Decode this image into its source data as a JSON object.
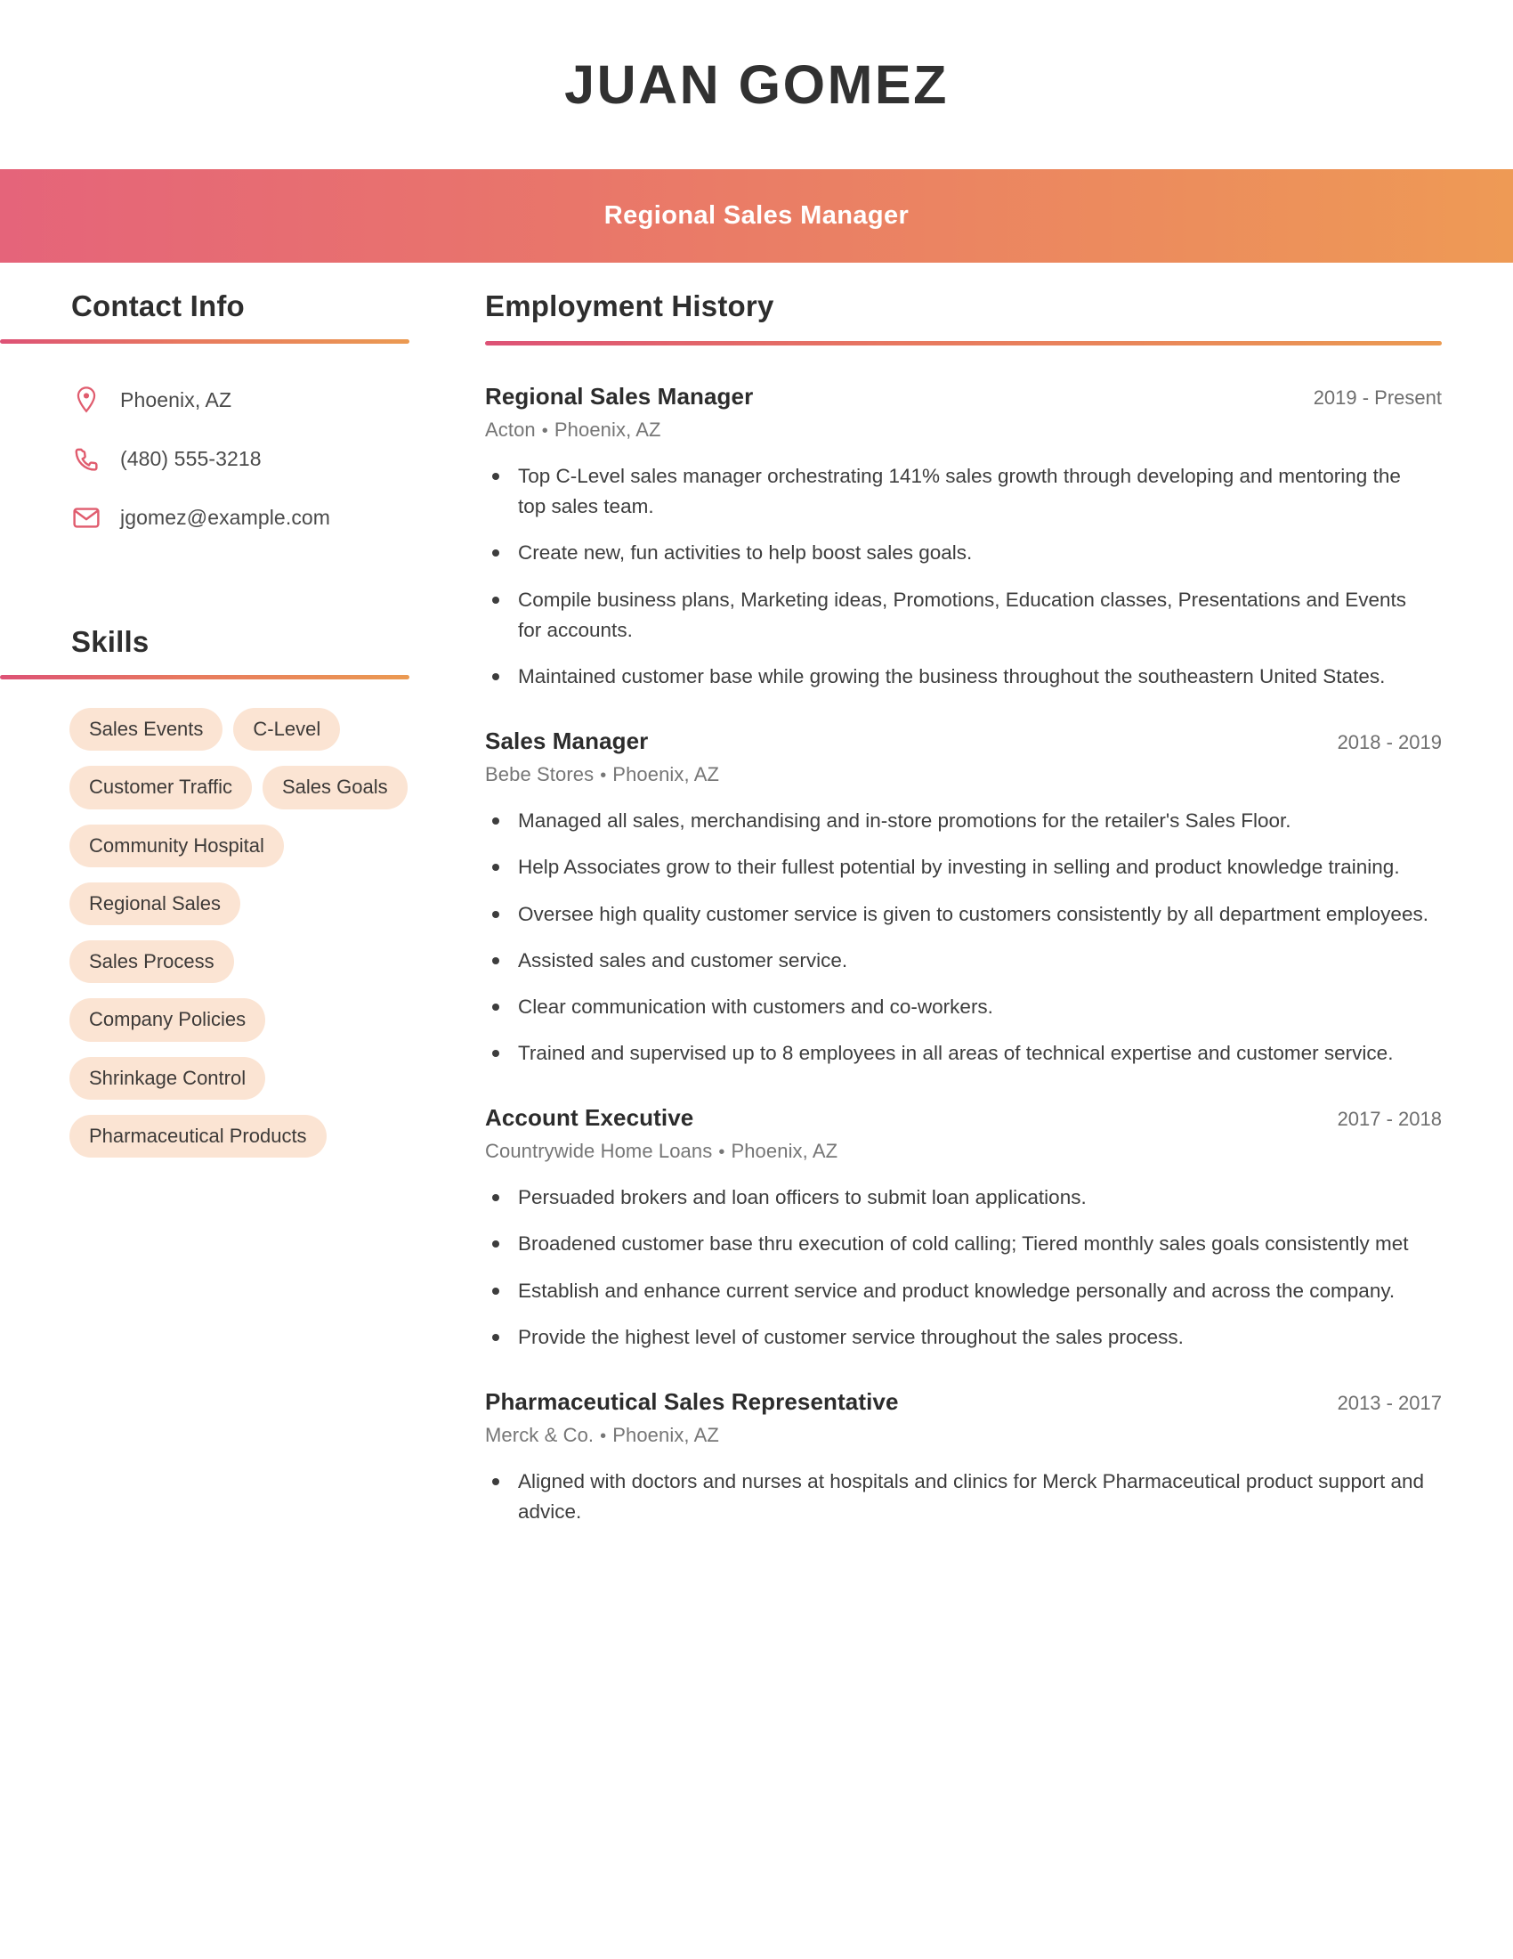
{
  "header": {
    "name": "JUAN GOMEZ",
    "title": "Regional Sales Manager",
    "gradient_start": "#e5647a",
    "gradient_end": "#ee9a55"
  },
  "sidebar": {
    "contact": {
      "heading": "Contact Info",
      "items": [
        {
          "icon": "location-pin-icon",
          "value": "Phoenix, AZ"
        },
        {
          "icon": "phone-icon",
          "value": "(480) 555-3218"
        },
        {
          "icon": "envelope-icon",
          "value": "jgomez@example.com"
        }
      ]
    },
    "skills": {
      "heading": "Skills",
      "pill_color": "#fbe4d3",
      "items": [
        "Sales Events",
        "C-Level",
        "Customer Traffic",
        "Sales Goals",
        "Community Hospital",
        "Regional Sales",
        "Sales Process",
        "Company Policies",
        "Shrinkage Control",
        "Pharmaceutical Products"
      ]
    }
  },
  "main": {
    "heading": "Employment History",
    "jobs": [
      {
        "title": "Regional Sales Manager",
        "dates": "2019 - Present",
        "company": "Acton",
        "location": "Phoenix, AZ",
        "bullets": [
          "Top C-Level sales manager orchestrating 141% sales growth through developing and mentoring the top sales team.",
          "Create new, fun activities to help boost sales goals.",
          "Compile business plans, Marketing ideas, Promotions, Education classes, Presentations and Events for accounts.",
          "Maintained customer base while growing the business throughout the southeastern United States."
        ]
      },
      {
        "title": "Sales Manager",
        "dates": "2018 - 2019",
        "company": "Bebe Stores",
        "location": "Phoenix, AZ",
        "bullets": [
          "Managed all sales, merchandising and in-store promotions for the retailer's Sales Floor.",
          "Help Associates grow to their fullest potential by investing in selling and product knowledge training.",
          "Oversee high quality customer service is given to customers consistently by all department employees.",
          "Assisted sales and customer service.",
          "Clear communication with customers and co-workers.",
          "Trained and supervised up to 8 employees in all areas of technical expertise and customer service."
        ]
      },
      {
        "title": "Account Executive",
        "dates": "2017 - 2018",
        "company": "Countrywide Home Loans",
        "location": "Phoenix, AZ",
        "bullets": [
          "Persuaded brokers and loan officers to submit loan applications.",
          "Broadened customer base thru execution of cold calling; Tiered monthly sales goals consistently met",
          "Establish and enhance current service and product knowledge personally and across the company.",
          "Provide the highest level of customer service throughout the sales process."
        ]
      },
      {
        "title": "Pharmaceutical Sales Representative",
        "dates": "2013 - 2017",
        "company": "Merck & Co.",
        "location": "Phoenix, AZ",
        "bullets": [
          "Aligned with doctors and nurses at hospitals and clinics for Merck Pharmaceutical product support and advice."
        ]
      }
    ]
  }
}
